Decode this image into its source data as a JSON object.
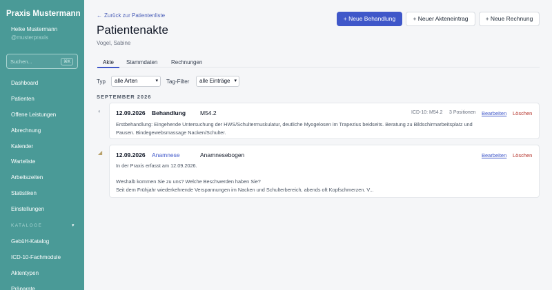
{
  "sidebar": {
    "brand": "Praxis Mustermann",
    "user_name": "Heike Mustermann",
    "user_handle": "@musterpraxis",
    "search_placeholder": "Suchen...",
    "search_shortcut": "⌘K",
    "items": [
      {
        "label": "Dashboard"
      },
      {
        "label": "Patienten"
      },
      {
        "label": "Offene Leistungen"
      },
      {
        "label": "Abrechnung"
      },
      {
        "label": "Kalender"
      },
      {
        "label": "Warteliste"
      },
      {
        "label": "Arbeitszeiten"
      },
      {
        "label": "Statistiken"
      },
      {
        "label": "Einstellungen"
      }
    ],
    "section_label": "KATALOGE",
    "section_chevron": "▾",
    "catalog_items": [
      {
        "label": "GebüH-Katalog"
      },
      {
        "label": "ICD-10-Fachmodule"
      },
      {
        "label": "Aktentypen"
      },
      {
        "label": "Präparate"
      }
    ]
  },
  "header": {
    "back_link": "Zurück zur Patientenliste",
    "back_arrow": "←",
    "title": "Patientenakte",
    "patient_name": "Vogel, Sabine",
    "buttons": {
      "new_treatment": "+ Neue Behandlung",
      "new_file_entry": "+ Neuer Akteneintrag",
      "new_invoice": "+ Neue Rechnung"
    }
  },
  "tabs": [
    {
      "label": "Akte"
    },
    {
      "label": "Stammdaten"
    },
    {
      "label": "Rechnungen"
    }
  ],
  "filters": {
    "type_label": "Typ",
    "type_value": "alle Arten",
    "tag_label": "Tag-Filter",
    "tag_value": "alle Einträge"
  },
  "timeline": {
    "month": "SEPTEMBER 2026",
    "entries": [
      {
        "date": "12.09.2026",
        "type": "Behandlung",
        "code": "M54.2",
        "icd": "ICD-10: M54.2",
        "positions": "3 Positionen",
        "edit": "Bearbeiten",
        "delete": "Löschen",
        "text_lines": [
          "Erstbehandlung: Eingehende Untersuchung der HWS/Schultermuskulatur, deutliche Myogelosen im Trapezius beidseits. Beratung zu Bildschirmarbeitsplatz und",
          "Pausen. Bindegewebsmassage Nacken/Schulter."
        ]
      },
      {
        "date": "12.09.2026",
        "type": "Anamnese",
        "code": "Anamnesebogen",
        "edit": "Bearbeiten",
        "delete": "Löschen",
        "text_lines": [
          "In der Praxis erfasst am 12.09.2026.",
          "Weshalb kommen Sie zu uns? Welche Beschwerden haben Sie?",
          "Seit dem Frühjahr wiederkehrende Verspannungen im Nacken und Schulterbereich, abends oft Kopfschmerzen. V..."
        ]
      }
    ]
  }
}
